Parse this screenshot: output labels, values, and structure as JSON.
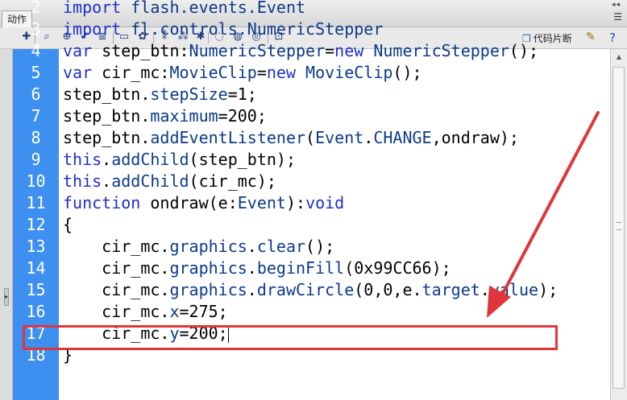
{
  "panel": {
    "tab_label": "动作",
    "collapse_glyph": "◂◂",
    "menu_glyph": "☰"
  },
  "toolbar": {
    "icons": [
      {
        "name": "add-statement-icon",
        "glyph": "✚"
      },
      {
        "name": "find-icon",
        "glyph": "⌕"
      },
      {
        "name": "insert-target-path-icon",
        "glyph": "⊕"
      },
      {
        "name": "check-syntax-icon",
        "glyph": "✔"
      },
      {
        "name": "auto-format-icon",
        "glyph": "≣"
      },
      {
        "name": "show-code-hint-icon",
        "glyph": "▭"
      },
      {
        "name": "debug-options-icon",
        "glyph": "✿"
      },
      {
        "name": "collapse-between-braces-icon",
        "glyph": "⁑"
      },
      {
        "name": "collapse-selection-icon",
        "glyph": "⁂"
      },
      {
        "name": "expand-all-icon",
        "glyph": "✱"
      },
      {
        "name": "apply-block-comment-icon",
        "glyph": "◌"
      },
      {
        "name": "apply-line-comment-icon",
        "glyph": "◍"
      },
      {
        "name": "remove-comment-icon",
        "glyph": "◎"
      },
      {
        "name": "show-hide-toolbox-icon",
        "glyph": "⊡"
      }
    ],
    "snippets_label": "代码片断",
    "snippets_icon_glyph": "❐",
    "wand_glyph": "✎",
    "help_glyph": "?"
  },
  "editor": {
    "lines": [
      {
        "num": "2",
        "tokens": [
          {
            "t": "import",
            "c": "kw"
          },
          {
            "t": " flash.events.Event",
            "c": "id"
          }
        ]
      },
      {
        "num": "3",
        "tokens": [
          {
            "t": "import",
            "c": "kw"
          },
          {
            "t": " fl.controls.NumericStepper",
            "c": "id"
          }
        ]
      },
      {
        "num": "4",
        "tokens": [
          {
            "t": "var",
            "c": "kw"
          },
          {
            "t": " step_btn:",
            "c": ""
          },
          {
            "t": "NumericStepper",
            "c": "id"
          },
          {
            "t": "=",
            "c": ""
          },
          {
            "t": "new",
            "c": "kw"
          },
          {
            "t": " ",
            "c": ""
          },
          {
            "t": "NumericStepper",
            "c": "id"
          },
          {
            "t": "();",
            "c": ""
          }
        ]
      },
      {
        "num": "5",
        "tokens": [
          {
            "t": "var",
            "c": "kw"
          },
          {
            "t": " cir_mc:",
            "c": ""
          },
          {
            "t": "MovieClip",
            "c": "id"
          },
          {
            "t": "=",
            "c": ""
          },
          {
            "t": "new",
            "c": "kw"
          },
          {
            "t": " ",
            "c": ""
          },
          {
            "t": "MovieClip",
            "c": "id"
          },
          {
            "t": "();",
            "c": ""
          }
        ]
      },
      {
        "num": "6",
        "tokens": [
          {
            "t": "step_btn.",
            "c": ""
          },
          {
            "t": "stepSize",
            "c": "id"
          },
          {
            "t": "=1;",
            "c": ""
          }
        ]
      },
      {
        "num": "7",
        "tokens": [
          {
            "t": "step_btn.",
            "c": ""
          },
          {
            "t": "maximum",
            "c": "id"
          },
          {
            "t": "=200;",
            "c": ""
          }
        ]
      },
      {
        "num": "8",
        "tokens": [
          {
            "t": "step_btn.",
            "c": ""
          },
          {
            "t": "addEventListener",
            "c": "id"
          },
          {
            "t": "(",
            "c": ""
          },
          {
            "t": "Event",
            "c": "id"
          },
          {
            "t": ".",
            "c": ""
          },
          {
            "t": "CHANGE",
            "c": "id"
          },
          {
            "t": ",ondraw);",
            "c": ""
          }
        ]
      },
      {
        "num": "9",
        "tokens": [
          {
            "t": "this",
            "c": "kw"
          },
          {
            "t": ".",
            "c": ""
          },
          {
            "t": "addChild",
            "c": "id"
          },
          {
            "t": "(step_btn);",
            "c": ""
          }
        ]
      },
      {
        "num": "10",
        "tokens": [
          {
            "t": "this",
            "c": "kw"
          },
          {
            "t": ".",
            "c": ""
          },
          {
            "t": "addChild",
            "c": "id"
          },
          {
            "t": "(cir_mc);",
            "c": ""
          }
        ]
      },
      {
        "num": "11",
        "tokens": [
          {
            "t": "function",
            "c": "kw"
          },
          {
            "t": " ondraw(e:",
            "c": ""
          },
          {
            "t": "Event",
            "c": "id"
          },
          {
            "t": "):",
            "c": ""
          },
          {
            "t": "void",
            "c": "kw"
          }
        ]
      },
      {
        "num": "12",
        "tokens": [
          {
            "t": "{",
            "c": ""
          }
        ]
      },
      {
        "num": "13",
        "tokens": [
          {
            "t": "    cir_mc.",
            "c": ""
          },
          {
            "t": "graphics",
            "c": "id"
          },
          {
            "t": ".",
            "c": ""
          },
          {
            "t": "clear",
            "c": "id"
          },
          {
            "t": "();",
            "c": ""
          }
        ]
      },
      {
        "num": "14",
        "tokens": [
          {
            "t": "    cir_mc.",
            "c": ""
          },
          {
            "t": "graphics",
            "c": "id"
          },
          {
            "t": ".",
            "c": ""
          },
          {
            "t": "beginFill",
            "c": "id"
          },
          {
            "t": "(0x99CC66);",
            "c": ""
          }
        ]
      },
      {
        "num": "15",
        "tokens": [
          {
            "t": "    cir_mc.",
            "c": ""
          },
          {
            "t": "graphics",
            "c": "id"
          },
          {
            "t": ".",
            "c": ""
          },
          {
            "t": "drawCircle",
            "c": "id"
          },
          {
            "t": "(0,0,e.",
            "c": ""
          },
          {
            "t": "target",
            "c": "id"
          },
          {
            "t": ".",
            "c": ""
          },
          {
            "t": "value",
            "c": "id"
          },
          {
            "t": ");",
            "c": ""
          }
        ]
      },
      {
        "num": "16",
        "tokens": [
          {
            "t": "    cir_mc.",
            "c": ""
          },
          {
            "t": "x",
            "c": "id"
          },
          {
            "t": "=275;",
            "c": ""
          }
        ]
      },
      {
        "num": "17",
        "tokens": [
          {
            "t": "    cir_mc.",
            "c": ""
          },
          {
            "t": "y",
            "c": "id"
          },
          {
            "t": "=200;",
            "c": ""
          }
        ],
        "caret": true
      },
      {
        "num": "18",
        "tokens": [
          {
            "t": "}",
            "c": ""
          }
        ]
      }
    ],
    "highlighted_line": "15"
  },
  "colors": {
    "gutter": "#3d8ff0",
    "keyword": "#1f2fc8",
    "identifier": "#0b3a8a",
    "annotation": "#e0353d"
  }
}
